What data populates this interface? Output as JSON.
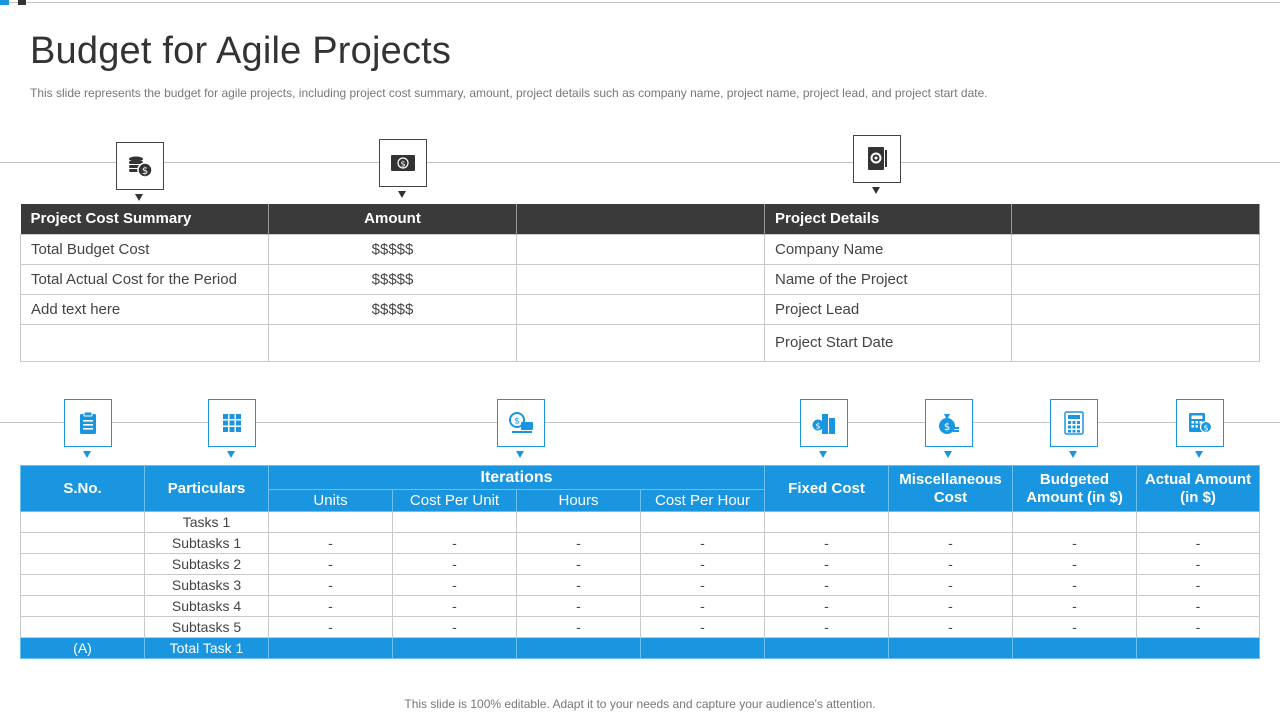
{
  "title": "Budget for Agile Projects",
  "subtitle": "This slide represents the budget for agile projects, including project cost summary, amount, project details such as company name, project name, project lead, and project start date.",
  "icons_top": [
    "coins-dollar-icon",
    "banknote-icon",
    "document-gear-icon"
  ],
  "icons_bottom": [
    "clipboard-icon",
    "grid-icon",
    "money-analytics-icon",
    "building-dollar-icon",
    "money-bag-icon",
    "calculator-icon",
    "calculator-dollar-icon"
  ],
  "summary_table": {
    "headers": [
      "Project Cost Summary",
      "Amount",
      "",
      "Project Details",
      ""
    ],
    "rows": [
      [
        "Total Budget Cost",
        "$$$$$",
        "",
        "Company Name",
        ""
      ],
      [
        "Total Actual Cost for the Period",
        "$$$$$",
        "",
        "Name of the Project",
        ""
      ],
      [
        "Add text here",
        "$$$$$",
        "",
        "Project Lead",
        ""
      ],
      [
        "",
        "",
        "",
        "Project Start Date",
        ""
      ]
    ]
  },
  "budget_table": {
    "headers": {
      "sno": "S.No.",
      "particulars": "Particulars",
      "iterations": "Iterations",
      "iteration_cols": [
        "Units",
        "Cost Per Unit",
        "Hours",
        "Cost Per Hour"
      ],
      "fixed_cost": "Fixed Cost",
      "misc_cost": "Miscellaneous Cost",
      "budgeted": "Budgeted Amount  (in $)",
      "actual": "Actual Amount (in $)"
    },
    "rows": [
      [
        "",
        "Tasks 1",
        "",
        "",
        "",
        "",
        "",
        "",
        "",
        ""
      ],
      [
        "",
        "Subtasks 1",
        "-",
        "-",
        "-",
        "-",
        "-",
        "-",
        "-",
        "-"
      ],
      [
        "",
        "Subtasks 2",
        "-",
        "-",
        "-",
        "-",
        "-",
        "-",
        "-",
        "-"
      ],
      [
        "",
        "Subtasks 3",
        "-",
        "-",
        "-",
        "-",
        "-",
        "-",
        "-",
        "-"
      ],
      [
        "",
        "Subtasks 4",
        "-",
        "-",
        "-",
        "-",
        "-",
        "-",
        "-",
        "-"
      ],
      [
        "",
        "Subtasks 5",
        "-",
        "-",
        "-",
        "-",
        "-",
        "-",
        "-",
        "-"
      ]
    ],
    "total_row": [
      "(A)",
      "Total Task 1",
      "",
      "",
      "",
      "",
      "",
      "",
      "",
      ""
    ]
  },
  "footer": "This slide is 100% editable. Adapt it to your needs and capture your audience's attention.",
  "colors": {
    "accent": "#1a96e0",
    "header_dark": "#3b3a3a"
  }
}
